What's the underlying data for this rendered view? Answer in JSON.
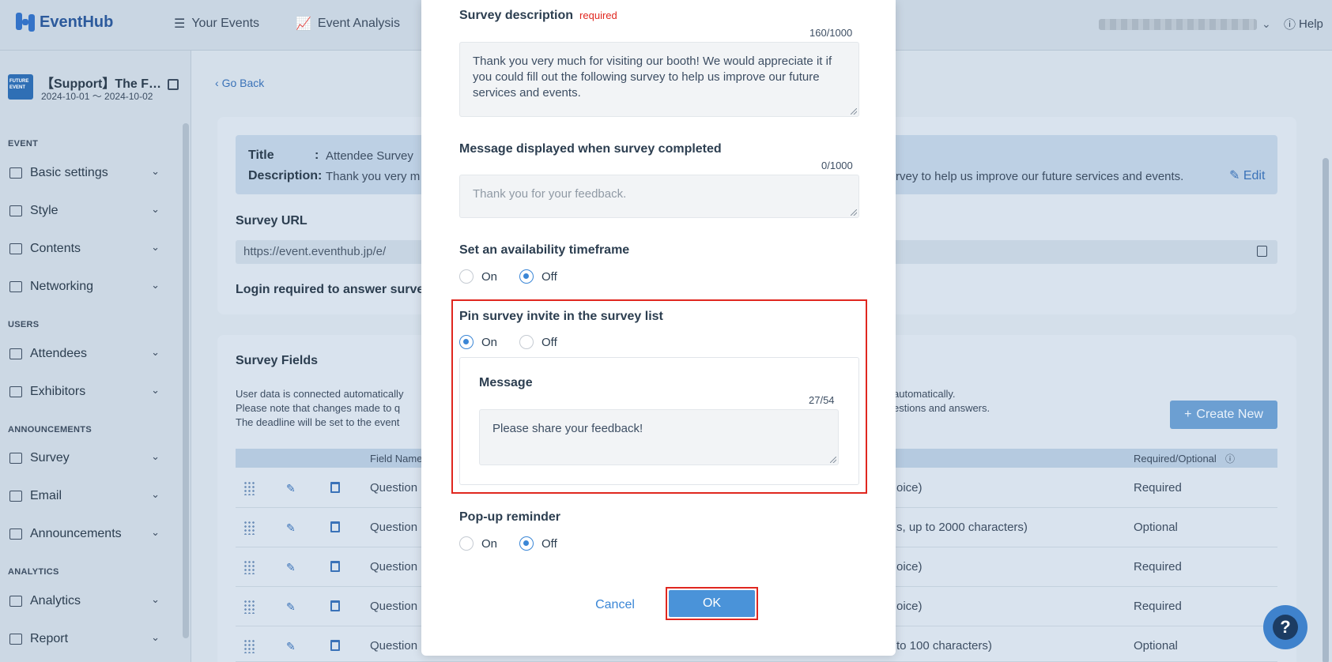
{
  "app": {
    "logo": "EventHub",
    "nav": {
      "your_events": "Your Events",
      "event_analysis": "Event Analysis",
      "help": "Help"
    }
  },
  "sidebar": {
    "event_name": "【Support】The F…",
    "event_dates": "2024-10-01 ～ 2024-10-02",
    "thumb_text": "FUTURE EVENT",
    "sections": {
      "event": "EVENT",
      "users": "USERS",
      "announcements": "ANNOUNCEMENTS",
      "analytics": "ANALYTICS"
    },
    "items": {
      "basic_settings": "Basic settings",
      "style": "Style",
      "contents": "Contents",
      "networking": "Networking",
      "attendees": "Attendees",
      "exhibitors": "Exhibitors",
      "survey": "Survey",
      "email": "Email",
      "announcements": "Announcements",
      "analytics": "Analytics",
      "report": "Report"
    }
  },
  "main": {
    "go_back": "Go Back",
    "info": {
      "title_label": "Title",
      "title_sep": ":",
      "title_value": "Attendee Survey",
      "desc_label": "Description:",
      "desc_value_left": "Thank you very m",
      "desc_value_right": "rvey to help us improve our future services and events.",
      "edit": "Edit"
    },
    "survey_url_label": "Survey URL",
    "survey_url_value": "https://event.eventhub.jp/e/",
    "login_required_label": "Login required to answer surve",
    "survey_fields": {
      "title": "Survey Fields",
      "note_left": [
        "User data is connected automatically",
        "Please note that changes made to q",
        "The deadline will be set to the event"
      ],
      "note_right": [
        "automatically.",
        "estions and answers."
      ],
      "create_new": "Create New",
      "col_field_name": "Field Name",
      "col_required": "Required/Optional",
      "rows": [
        {
          "name": "Question",
          "type": "oice)",
          "req": "Required"
        },
        {
          "name": "Question",
          "type": "s, up to 2000 characters)",
          "req": "Optional"
        },
        {
          "name": "Question",
          "type": "oice)",
          "req": "Required"
        },
        {
          "name": "Question",
          "type": "oice)",
          "req": "Required"
        },
        {
          "name": "Question",
          "type": "to 100 characters)",
          "req": "Optional"
        }
      ]
    }
  },
  "modal": {
    "desc_label": "Survey description",
    "required_tag": "required",
    "desc_counter": "160/1000",
    "desc_value": "Thank you very much for visiting our booth! We would appreciate it if you could fill out the following survey to help us improve our future services and events.",
    "completed_label": "Message displayed when survey completed",
    "completed_counter": "0/1000",
    "completed_placeholder": "Thank you for your feedback.",
    "timeframe_label": "Set an availability timeframe",
    "pin_label": "Pin survey invite in the survey list",
    "message_label": "Message",
    "message_counter": "27/54",
    "message_value": "Please share your feedback!",
    "popup_label": "Pop-up reminder",
    "on": "On",
    "off": "Off",
    "cancel": "Cancel",
    "ok": "OK"
  },
  "colors": {
    "accent": "#4a93d9",
    "highlight": "#e0271f"
  }
}
